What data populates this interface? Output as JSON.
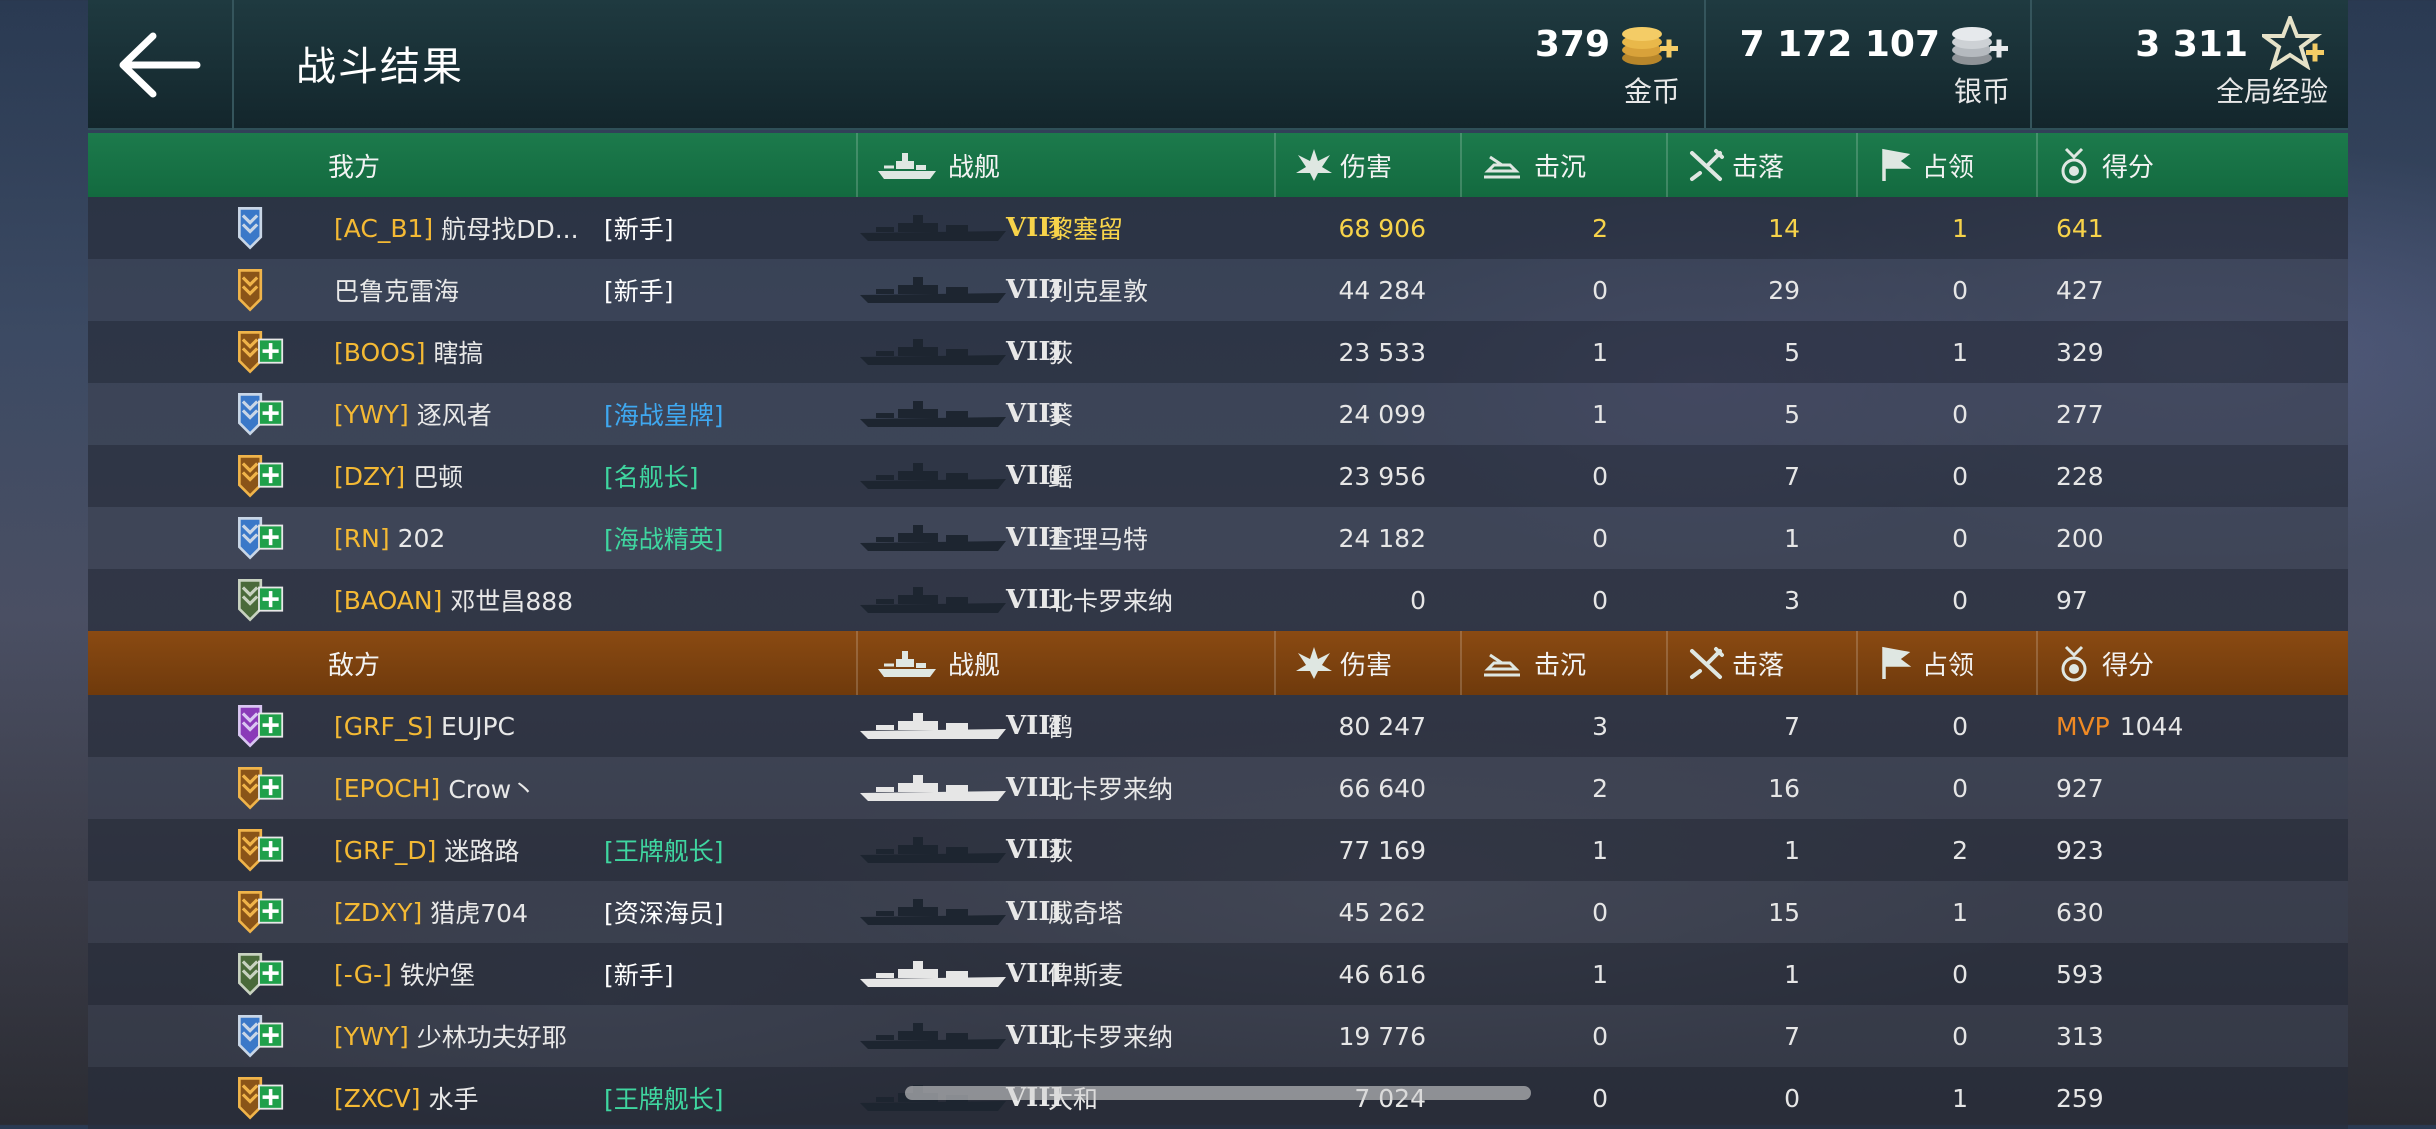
{
  "header": {
    "title": "战斗结果",
    "currencies": [
      {
        "value": "379",
        "label": "金币",
        "icon": "gold-coins-icon"
      },
      {
        "value": "7 172 107",
        "label": "银币",
        "icon": "silver-coins-icon"
      },
      {
        "value": "3 311",
        "label": "全局经验",
        "icon": "star-icon"
      }
    ]
  },
  "columns": {
    "ship": "战舰",
    "damage": "伤害",
    "kills": "击沉",
    "planes": "击落",
    "capture": "占领",
    "score": "得分"
  },
  "teams": [
    {
      "label": "我方",
      "color": "#1c7a4c",
      "players": [
        {
          "clan": "[AC_B1]",
          "name": "航母找DD...",
          "tag": "[新手]",
          "tag_color": "#ffffff",
          "tier": "VIII",
          "ship": "黎塞留",
          "damage": "68 906",
          "kills": "2",
          "planes": "14",
          "capture": "1",
          "score": "641",
          "highlight": true,
          "rank": "silver",
          "ship_color": "#1d2530"
        },
        {
          "clan": "",
          "name": "巴鲁克雷海",
          "tag": "[新手]",
          "tag_color": "#ffffff",
          "tier": "VIII",
          "ship": "列克星敦",
          "damage": "44 284",
          "kills": "0",
          "planes": "29",
          "capture": "0",
          "score": "427",
          "highlight": false,
          "rank": "gold",
          "ship_color": "#1d2530"
        },
        {
          "clan": "[BOOS]",
          "name": "瞎搞",
          "tag": "",
          "tag_color": "#ffffff",
          "tier": "VIII",
          "ship": "荻",
          "damage": "23 533",
          "kills": "1",
          "planes": "5",
          "capture": "1",
          "score": "329",
          "highlight": false,
          "rank": "gold",
          "ship_color": "#1d2530"
        },
        {
          "clan": "[YWY]",
          "name": "逐风者",
          "tag": "[海战皇牌]",
          "tag_color": "#3fa8f0",
          "tier": "VIII",
          "ship": "葵",
          "damage": "24 099",
          "kills": "1",
          "planes": "5",
          "capture": "0",
          "score": "277",
          "highlight": false,
          "rank": "silver",
          "ship_color": "#1d2530"
        },
        {
          "clan": "[DZY]",
          "name": "巴顿",
          "tag": "[名舰长]",
          "tag_color": "#3fd6a0",
          "tier": "VIII",
          "ship": "鳐",
          "damage": "23 956",
          "kills": "0",
          "planes": "7",
          "capture": "0",
          "score": "228",
          "highlight": false,
          "rank": "gold",
          "ship_color": "#1d2530"
        },
        {
          "clan": "[RN]",
          "name": "202",
          "tag": "[海战精英]",
          "tag_color": "#3fd6a0",
          "tier": "VIII",
          "ship": "查理马特",
          "damage": "24 182",
          "kills": "0",
          "planes": "1",
          "capture": "0",
          "score": "200",
          "highlight": false,
          "rank": "silver",
          "ship_color": "#1d2530"
        },
        {
          "clan": "[BAOAN]",
          "name": "邓世昌888",
          "tag": "",
          "tag_color": "#ffffff",
          "tier": "VIII",
          "ship": "北卡罗来纳",
          "damage": "0",
          "kills": "0",
          "planes": "3",
          "capture": "0",
          "score": "97",
          "highlight": false,
          "rank": "green",
          "ship_color": "#1d2530"
        }
      ]
    },
    {
      "label": "敌方",
      "color": "#8a4a12",
      "players": [
        {
          "clan": "[GRF_S]",
          "name": "EUJPC",
          "tag": "",
          "tag_color": "#ffffff",
          "tier": "VIII",
          "ship": "鹤",
          "damage": "80 247",
          "kills": "3",
          "planes": "7",
          "capture": "0",
          "score": "1044",
          "mvp": "MVP",
          "highlight": false,
          "rank": "purple",
          "ship_color": "#e6e6e6"
        },
        {
          "clan": "[EPOCH]",
          "name": "Crow丶",
          "tag": "",
          "tag_color": "#ffffff",
          "tier": "VIII",
          "ship": "北卡罗来纳",
          "damage": "66 640",
          "kills": "2",
          "planes": "16",
          "capture": "0",
          "score": "927",
          "highlight": false,
          "rank": "gold",
          "ship_color": "#e6e6e6"
        },
        {
          "clan": "[GRF_D]",
          "name": "迷路路",
          "tag": "[王牌舰长]",
          "tag_color": "#3fd6a0",
          "tier": "VIII",
          "ship": "荻",
          "damage": "77 169",
          "kills": "1",
          "planes": "1",
          "capture": "2",
          "score": "923",
          "highlight": false,
          "rank": "gold",
          "ship_color": "#1d2530"
        },
        {
          "clan": "[ZDXY]",
          "name": "猎虎704",
          "tag": "[资深海员]",
          "tag_color": "#ffffff",
          "tier": "VIII",
          "ship": "威奇塔",
          "damage": "45 262",
          "kills": "0",
          "planes": "15",
          "capture": "1",
          "score": "630",
          "highlight": false,
          "rank": "gold",
          "ship_color": "#1d2530"
        },
        {
          "clan": "[-G-]",
          "name": "铁炉堡",
          "tag": "[新手]",
          "tag_color": "#ffffff",
          "tier": "VIII",
          "ship": "俾斯麦",
          "damage": "46 616",
          "kills": "1",
          "planes": "1",
          "capture": "0",
          "score": "593",
          "highlight": false,
          "rank": "green",
          "ship_color": "#e6e6e6"
        },
        {
          "clan": "[YWY]",
          "name": "少林功夫好耶",
          "tag": "",
          "tag_color": "#ffffff",
          "tier": "VIII",
          "ship": "北卡罗来纳",
          "damage": "19 776",
          "kills": "0",
          "planes": "7",
          "capture": "0",
          "score": "313",
          "highlight": false,
          "rank": "silver",
          "ship_color": "#1d2530"
        },
        {
          "clan": "[ZXCV]",
          "name": "水手",
          "tag": "[王牌舰长]",
          "tag_color": "#3fd6a0",
          "tier": "VIII",
          "ship": "大和",
          "damage": "7 024",
          "kills": "0",
          "planes": "0",
          "capture": "1",
          "score": "259",
          "highlight": false,
          "rank": "gold",
          "ship_color": "#1d2530"
        }
      ]
    }
  ]
}
